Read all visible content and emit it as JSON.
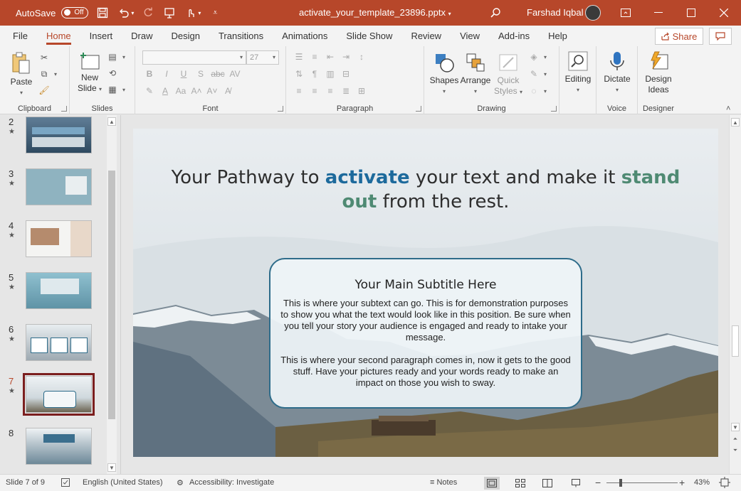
{
  "titlebar": {
    "autosave_label": "AutoSave",
    "autosave_state": "Off",
    "filename": "activate_your_template_23896.pptx",
    "user_name": "Farshad Iqbal"
  },
  "menu": {
    "tabs": [
      "File",
      "Home",
      "Insert",
      "Draw",
      "Design",
      "Transitions",
      "Animations",
      "Slide Show",
      "Review",
      "View",
      "Add-ins",
      "Help"
    ],
    "active_tab": "Home",
    "share_label": "Share"
  },
  "ribbon": {
    "clipboard": {
      "label": "Clipboard",
      "paste": "Paste"
    },
    "slides": {
      "label": "Slides",
      "new_slide_1": "New",
      "new_slide_2": "Slide"
    },
    "font": {
      "label": "Font",
      "font_name": "",
      "font_size": "27"
    },
    "paragraph": {
      "label": "Paragraph"
    },
    "drawing": {
      "label": "Drawing",
      "shapes": "Shapes",
      "arrange": "Arrange",
      "quick_styles_1": "Quick",
      "quick_styles_2": "Styles"
    },
    "editing": {
      "label": "Editing"
    },
    "voice": {
      "label": "Voice",
      "dictate": "Dictate"
    },
    "designer": {
      "label": "Designer",
      "design_ideas_1": "Design",
      "design_ideas_2": "Ideas"
    }
  },
  "thumbnails": [
    {
      "num": "2",
      "star": "★"
    },
    {
      "num": "3",
      "star": "★"
    },
    {
      "num": "4",
      "star": "★"
    },
    {
      "num": "5",
      "star": "★"
    },
    {
      "num": "6",
      "star": "★"
    },
    {
      "num": "7",
      "star": "★",
      "selected": true
    },
    {
      "num": "8",
      "star": "★"
    }
  ],
  "slide": {
    "title_part1": "Your Pathway to ",
    "title_hl1": "activate",
    "title_part2": " your text and make it ",
    "title_hl2": "stand out",
    "title_part3": " from the rest.",
    "subtitle": "Your Main Subtitle Here",
    "paragraph1": "This is where your subtext can go. This is for demonstration purposes to show you what the text would look like in this position. Be sure when you tell your story your audience is engaged and ready to intake your message.",
    "paragraph2": "This is where your second paragraph comes in, now it gets to the good stuff. Have your pictures ready and your words ready to make an impact on those you wish to sway."
  },
  "status": {
    "slide_info": "Slide 7 of 9",
    "language": "English (United States)",
    "accessibility": "Accessibility: Investigate",
    "notes": "Notes",
    "zoom": "43%",
    "zoom_fraction": 0.43
  },
  "colors": {
    "titlebar": "#b7472a",
    "accent_blue": "#1d6a9c",
    "accent_green": "#4f8a73",
    "box_border": "#2e6c8a",
    "selected_thumb": "#7b1e1e"
  }
}
